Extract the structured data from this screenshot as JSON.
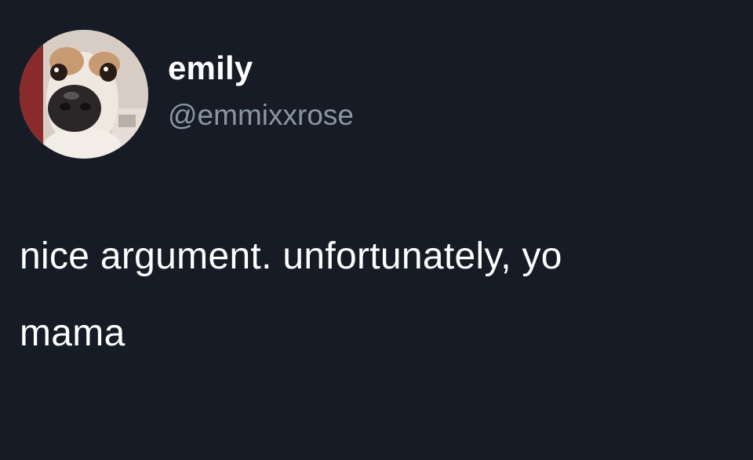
{
  "author": {
    "display_name": "emily",
    "handle": "@emmixxrose"
  },
  "tweet": {
    "lines": [
      "nice argument. unfortunately, yo",
      "mama"
    ]
  },
  "colors": {
    "background": "#161b26",
    "text": "#ffffff",
    "handle": "#8b96a3"
  },
  "icons": {
    "avatar": "dog-photo-avatar"
  }
}
